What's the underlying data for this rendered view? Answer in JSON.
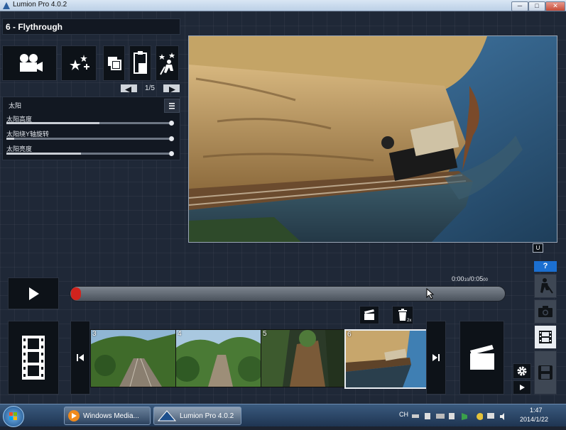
{
  "window": {
    "title": "Lumion Pro 4.0.2",
    "minimize": "─",
    "maximize": "□",
    "close": "✕"
  },
  "mode_title": "6 - Flythrough",
  "tools": [
    {
      "icon": "movie-camera-icon"
    },
    {
      "icon": "effects-sparkle-icon"
    },
    {
      "icon": "copy-icon"
    },
    {
      "icon": "paste-icon"
    },
    {
      "icon": "clean-effects-icon"
    }
  ],
  "pager": {
    "text": "1/5"
  },
  "effect_panel": {
    "title": "太阳",
    "sliders": [
      {
        "label": "太阳高度",
        "value": 0.57
      },
      {
        "label": "太阳绕Y轴旋转",
        "value": 0.05
      },
      {
        "label": "太阳亮度",
        "value": 0.46
      }
    ]
  },
  "viewport_badge": "U",
  "help": "?",
  "timeline": {
    "time_current": "0:00",
    "time_current_frac": "10",
    "time_total": "0:05",
    "time_total_frac": "00",
    "progress": 0.015
  },
  "clip_actions": {
    "delete_badge": "2x"
  },
  "clips": [
    {
      "num": "3",
      "scene": "forest-track"
    },
    {
      "num": "4",
      "scene": "forest-valley"
    },
    {
      "num": "5",
      "scene": "rock-canyon"
    },
    {
      "num": "6",
      "scene": "cliff-train",
      "selected": true
    }
  ],
  "side_menu": [
    {
      "icon": "build-mode-icon"
    },
    {
      "icon": "photo-mode-icon"
    },
    {
      "icon": "movie-mode-icon",
      "active": true
    },
    {
      "icon": "save-icon"
    }
  ],
  "taskbar": {
    "tasks": [
      {
        "label": "Windows Media...",
        "icon": "media-player-icon"
      },
      {
        "label": "Lumion Pro 4.0.2",
        "icon": "lumion-icon",
        "active": true
      }
    ],
    "lang": "CH",
    "time": "1:47",
    "date": "2014/1/22"
  }
}
